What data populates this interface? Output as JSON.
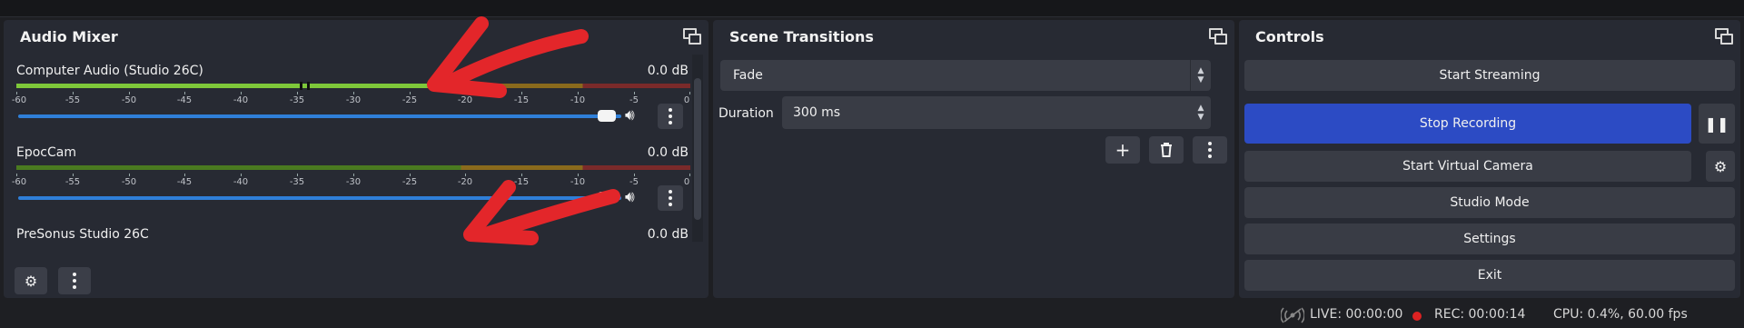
{
  "audio_mixer": {
    "title": "Audio Mixer",
    "channels": [
      {
        "name": "Computer Audio (Studio 26C)",
        "db": "0.0 dB"
      },
      {
        "name": "EpocCam",
        "db": "0.0 dB"
      },
      {
        "name": "PreSonus Studio 26C",
        "db": "0.0 dB"
      }
    ],
    "scale_labels": [
      "-60",
      "-55",
      "-50",
      "-45",
      "-40",
      "-35",
      "-30",
      "-25",
      "-20",
      "-15",
      "-10",
      "-5",
      "0"
    ]
  },
  "scene_transitions": {
    "title": "Scene Transitions",
    "transition": "Fade",
    "duration_label": "Duration",
    "duration_value": "300 ms"
  },
  "controls": {
    "title": "Controls",
    "start_streaming": "Start Streaming",
    "stop_recording": "Stop Recording",
    "start_virtual_camera": "Start Virtual Camera",
    "studio_mode": "Studio Mode",
    "settings": "Settings",
    "exit": "Exit"
  },
  "status_bar": {
    "live": "LIVE: 00:00:00",
    "rec": "REC: 00:00:14",
    "cpu": "CPU: 0.4%, 60.00 fps"
  },
  "colors": {
    "accent_blue": "#2c4bc4",
    "slider_blue": "#2f7fd8",
    "meter_green": "#7ec83a",
    "annotation_red": "#e3262a"
  }
}
